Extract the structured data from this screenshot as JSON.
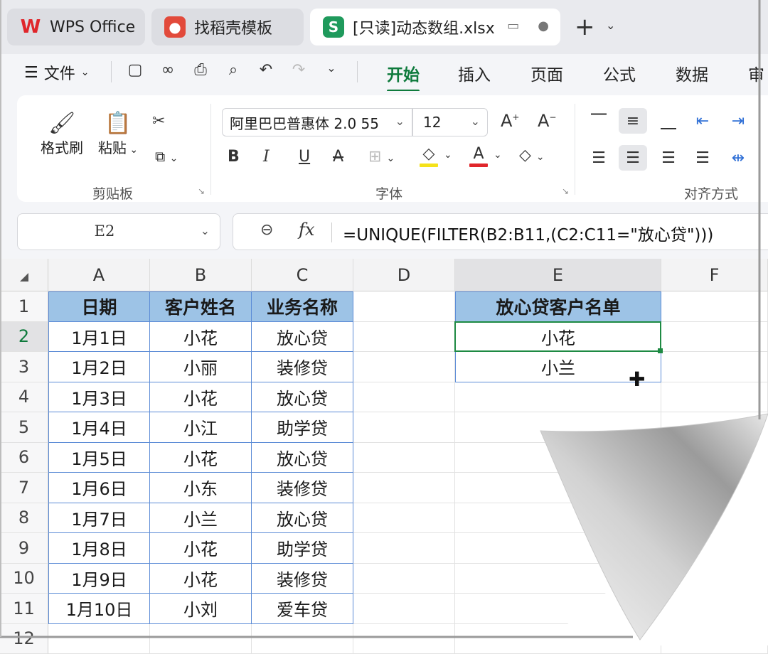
{
  "tabs": [
    {
      "label": "WPS Office",
      "icon": "wps-logo-icon"
    },
    {
      "label": "找稻壳模板",
      "icon": "daoke-icon"
    },
    {
      "label": "[只读]动态数组.xlsx",
      "icon": "sheet-icon",
      "icon_letter": "S"
    }
  ],
  "menu": {
    "file_label": "文件",
    "tabs": [
      "开始",
      "插入",
      "页面",
      "公式",
      "数据",
      "审"
    ]
  },
  "ribbon": {
    "format_painter": "格式刷",
    "paste": "粘贴",
    "clipboard_group": "剪贴板",
    "font_name": "阿里巴巴普惠体 2.0 55",
    "font_size": "12",
    "font_group": "字体",
    "align_group": "对齐方式"
  },
  "formula_bar": {
    "name_box": "E2",
    "fx": "fx",
    "formula": "=UNIQUE(FILTER(B2:B11,(C2:C11=\"放心贷\")))"
  },
  "grid": {
    "columns": [
      "A",
      "B",
      "C",
      "D",
      "E",
      "F"
    ],
    "rows": [
      "1",
      "2",
      "3",
      "4",
      "5",
      "6",
      "7",
      "8",
      "9",
      "10",
      "11",
      "12"
    ],
    "headers": [
      "日期",
      "客户姓名",
      "业务名称"
    ],
    "data": [
      [
        "1月1日",
        "小花",
        "放心贷"
      ],
      [
        "1月2日",
        "小丽",
        "装修贷"
      ],
      [
        "1月3日",
        "小花",
        "放心贷"
      ],
      [
        "1月4日",
        "小江",
        "助学贷"
      ],
      [
        "1月5日",
        "小花",
        "放心贷"
      ],
      [
        "1月6日",
        "小东",
        "装修贷"
      ],
      [
        "1月7日",
        "小兰",
        "放心贷"
      ],
      [
        "1月8日",
        "小花",
        "助学贷"
      ],
      [
        "1月9日",
        "小花",
        "装修贷"
      ],
      [
        "1月10日",
        "小刘",
        "爱车贷"
      ]
    ],
    "result_header": "放心贷客户名单",
    "result": [
      "小花",
      "小兰"
    ],
    "active_cell": "E2"
  },
  "colors": {
    "accent": "#0e7a3c",
    "table_header_fill": "#9dc3e6",
    "table_border": "#5b8bd6",
    "active_cell_border": "#1e8a43"
  }
}
